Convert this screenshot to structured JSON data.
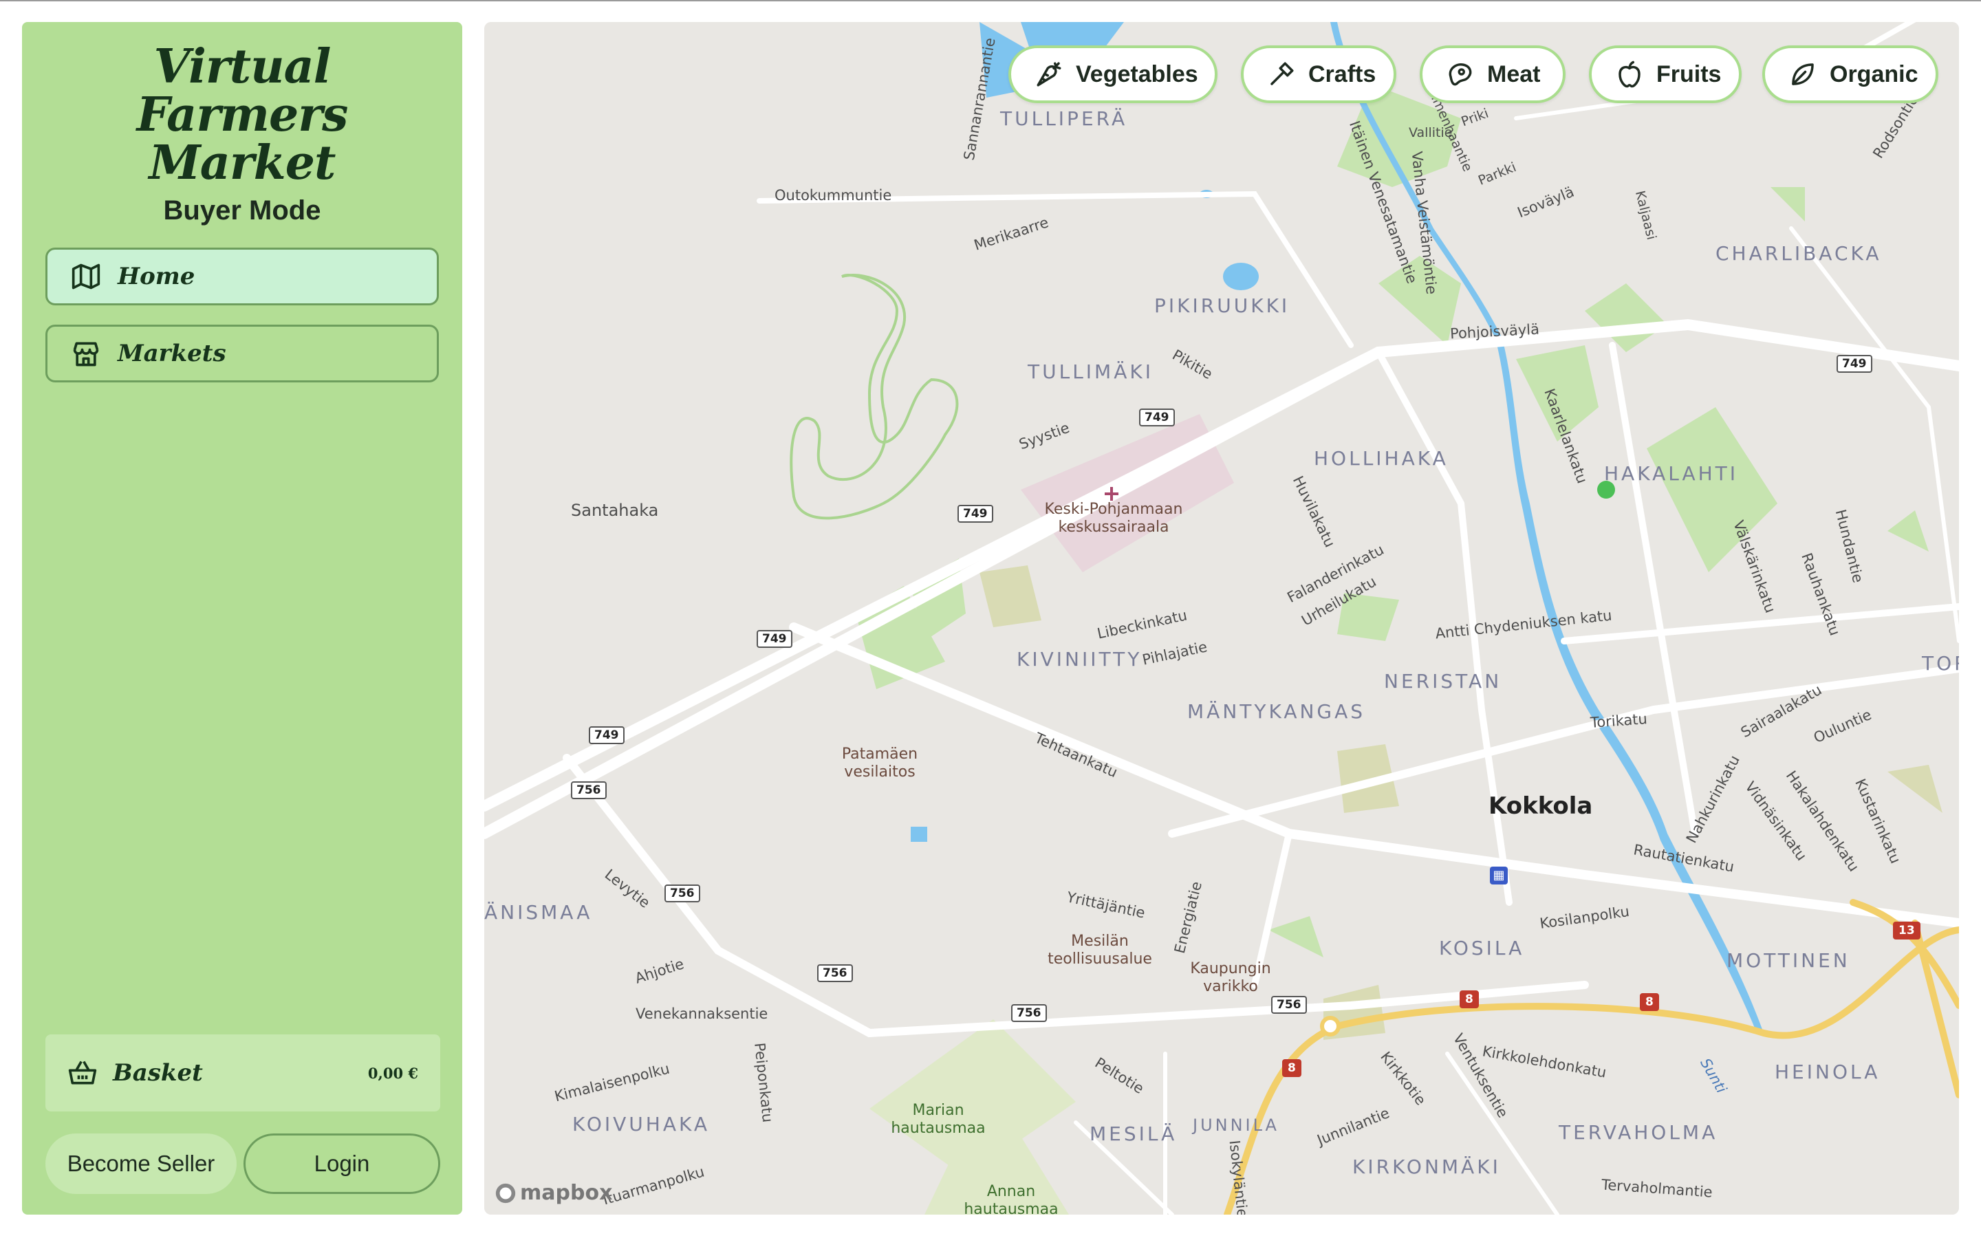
{
  "app": {
    "title": "Virtual Farmers Market",
    "mode_label": "Buyer Mode"
  },
  "nav": {
    "home_label": "Home",
    "markets_label": "Markets"
  },
  "basket": {
    "label": "Basket",
    "total": "0,00 €"
  },
  "actions": {
    "become_seller": "Become Seller",
    "login": "Login"
  },
  "filters": [
    {
      "label": "Vegetables",
      "icon": "carrot-icon"
    },
    {
      "label": "Crafts",
      "icon": "hammer-icon"
    },
    {
      "label": "Meat",
      "icon": "steak-icon"
    },
    {
      "label": "Fruits",
      "icon": "apple-icon"
    },
    {
      "label": "Organic",
      "icon": "leaf-icon"
    }
  ],
  "map": {
    "attribution": "mapbox",
    "city": "Kokkola",
    "districts": [
      "TULLIPERÄ",
      "CHARLIBACKA",
      "PIKIRUUKKI",
      "TULLIMÄKI",
      "HOLLIHAKA",
      "HAKALAHTI",
      "KIVINIITTY",
      "NERISTAN",
      "MÄNTYKANGAS",
      "ÄNISMAA",
      "KOSILA",
      "MOTTINEN",
      "HEINOLA",
      "KOIVUHAKA",
      "MESILÄ",
      "JUNNILA",
      "TERVAHOLMA",
      "KIRKONMÄKI",
      "TOR"
    ],
    "streets": [
      "Sannanrannantie",
      "Outokummuntie",
      "Merikaarre",
      "Vallitie",
      "Salmenhaantie",
      "Priki",
      "Parkki",
      "Isoväylä",
      "Kaljaasi",
      "Rodsontie",
      "Itäinen Venesatamantie",
      "Vanha Veistämöntie",
      "Pohjoisväylä",
      "Pikitie",
      "Syystie",
      "Kaarlelankatu",
      "Huvilakatu",
      "Falanderinkatu",
      "Urheilukatu",
      "Libeckinkatu",
      "Pihlajatie",
      "Antti Chydeniuksen katu",
      "Välskärinkatu",
      "Rauhankatu",
      "Hundantie",
      "Sairaalakatu",
      "Torikatu",
      "Oulunti­e",
      "Tehtaankatu",
      "Nahkurinkatu",
      "Vidnäsinkatu",
      "Hakalahdenkatu",
      "Kustarinkatu",
      "Rautatienkatu",
      "Kosilanpolku",
      "Yrittäjäntie",
      "Energiatie",
      "Levytie",
      "Ahjotie",
      "Venekannaksentie",
      "Kimalaisenpolku",
      "Peiponkatu",
      "Peltotie",
      "Kirkkotie",
      "Ventuksentie",
      "Junnilantie",
      "Kirkkolehdonkatu",
      "Isokyläntie",
      "Tervaholmantie",
      "Sunti",
      "Santahaka",
      "Ituarmanpolku"
    ],
    "pois": [
      "Keski-Pohjanmaan keskussairaala",
      "Patamäen vesilaitos",
      "Mesilän teollisuusalue",
      "Kaupungin varikko",
      "Marian hautausmaa",
      "Annan hautausmaa"
    ],
    "road_numbers": [
      "749",
      "756",
      "8",
      "13"
    ]
  }
}
